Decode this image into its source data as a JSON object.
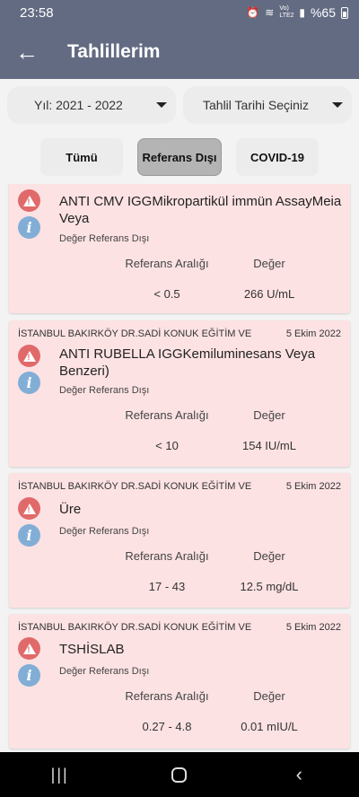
{
  "status": {
    "time": "23:58",
    "battery_text": "%65",
    "net": "Vo) LTE2"
  },
  "header": {
    "title": "Tahlillerim",
    "back_icon": "←"
  },
  "filters": {
    "year": "Yıl: 2021 - 2022",
    "date": "Tahlil Tarihi Seçiniz"
  },
  "tabs": [
    "Tümü",
    "Referans Dışı",
    "COVID-19"
  ],
  "labels": {
    "ref": "Referans Aralığı",
    "value": "Değer"
  },
  "results": [
    {
      "hospital": "",
      "date": "",
      "name": "ANTI CMV IGGMikropartikül immün AssayMeia Veya",
      "status": "Değer Referans Dışı",
      "ref": "< 0.5",
      "value": "266 U/mL"
    },
    {
      "hospital": "İSTANBUL BAKIRKÖY DR.SADİ KONUK EĞİTİM VE",
      "date": "5 Ekim 2022",
      "name": "ANTI RUBELLA IGGKemiluminesans Veya Benzeri)",
      "status": "Değer Referans Dışı",
      "ref": "< 10",
      "value": "154 IU/mL"
    },
    {
      "hospital": "İSTANBUL BAKIRKÖY DR.SADİ KONUK EĞİTİM VE",
      "date": "5 Ekim 2022",
      "name": "Üre",
      "status": "Değer Referans Dışı",
      "ref": "17 - 43",
      "value": "12.5 mg/dL"
    },
    {
      "hospital": "İSTANBUL BAKIRKÖY DR.SADİ KONUK EĞİTİM VE",
      "date": "5 Ekim 2022",
      "name": "TSHİSLAB",
      "status": "Değer Referans Dışı",
      "ref": "0.27 - 4.8",
      "value": "0.01 mIU/L"
    }
  ]
}
